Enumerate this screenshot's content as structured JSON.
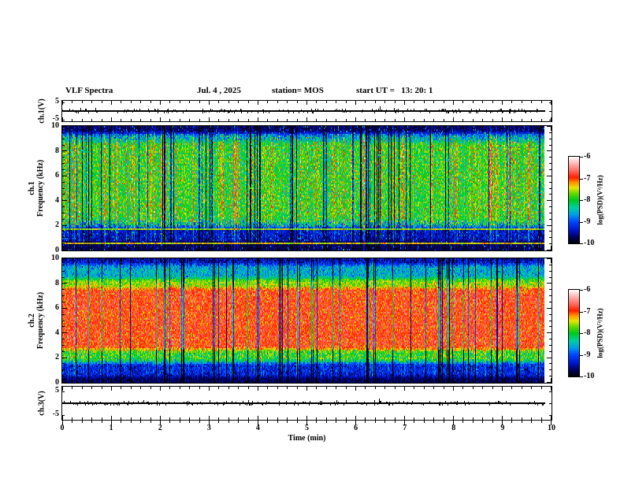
{
  "header": {
    "title": "VLF Spectra",
    "date": "Jul. 4 , 2025",
    "station": "station= MOS",
    "start_ut": "start UT =   13: 20: 1"
  },
  "time_axis": {
    "label": "Time (min)",
    "min": 0,
    "max": 10,
    "major_ticks": [
      0,
      1,
      2,
      3,
      4,
      5,
      6,
      7,
      8,
      9,
      10
    ],
    "minor_step": 0.2
  },
  "colormap": {
    "label": "log(PSD)(V²/Hz)",
    "ticks": [
      -6,
      -7,
      -8,
      -9,
      -10
    ],
    "min": -10,
    "max": -6,
    "stops": [
      [
        0,
        "#000006"
      ],
      [
        0.07,
        "#000055"
      ],
      [
        0.15,
        "#0013c8"
      ],
      [
        0.25,
        "#0045ff"
      ],
      [
        0.33,
        "#009ce6"
      ],
      [
        0.41,
        "#00cfa0"
      ],
      [
        0.5,
        "#00c81e"
      ],
      [
        0.58,
        "#6ed800"
      ],
      [
        0.64,
        "#e6e600"
      ],
      [
        0.7,
        "#ff9600"
      ],
      [
        0.76,
        "#ff1e00"
      ],
      [
        0.84,
        "#ff6e64"
      ],
      [
        0.92,
        "#ffb4b4"
      ],
      [
        1,
        "#ffffff"
      ]
    ]
  },
  "chart_data": [
    {
      "type": "line",
      "name": "ch1_voltage",
      "ylabel": "ch.1(V)",
      "ylim": [
        -5.9,
        5.9
      ],
      "yticks": [
        5,
        -5
      ],
      "signal": "flat trace near 0 V with sparse small impulsive spikes"
    },
    {
      "type": "heatmap",
      "name": "ch1_spectrogram",
      "ylabel_line1": "ch.1",
      "ylabel_line2": "Frequency (kHz)",
      "xlim": [
        0,
        10
      ],
      "ylim": [
        0,
        10
      ],
      "zlim": [
        -10,
        -6
      ],
      "yticks": [
        0,
        2,
        4,
        6,
        8,
        10
      ],
      "data_end": 9.85,
      "bands": [
        {
          "f": [
            9.35,
            10.0
          ],
          "level": -9.7,
          "noise": 0.25,
          "streak_weight": 0.35
        },
        {
          "f": [
            8.7,
            9.35
          ],
          "level": -8.6,
          "noise": 0.5,
          "streak_weight": 0.8
        },
        {
          "f": [
            2.45,
            8.7
          ],
          "level": -7.95,
          "noise": 0.45,
          "streak_weight": 1.0
        },
        {
          "f": [
            1.95,
            2.45
          ],
          "level": -8.3,
          "noise": 0.8,
          "streak_weight": 0.8
        },
        {
          "f": [
            0.8,
            1.95
          ],
          "level": -9.4,
          "noise": 0.35,
          "streak_weight": 0.6
        },
        {
          "f": [
            0.0,
            0.8
          ],
          "level": -9.75,
          "noise": 0.2,
          "streak_weight": 0.3
        }
      ],
      "lines": [
        {
          "f": 1.75,
          "level": -7.6
        },
        {
          "f": 0.6,
          "level": -7.4
        }
      ],
      "streaks": {
        "dark_prob": 0.13,
        "dark_depth": [
          1.0,
          2.2
        ],
        "bright_prob": 0.1,
        "bright_boost": [
          0.5,
          1.1
        ],
        "dark_gain": 1.0
      },
      "speck_prob": 0.05,
      "speck_boost": 1.15
    },
    {
      "type": "heatmap",
      "name": "ch2_spectrogram",
      "ylabel_line1": "ch.2",
      "ylabel_line2": "Frequency (kHz)",
      "xlim": [
        0,
        10
      ],
      "ylim": [
        0,
        10
      ],
      "zlim": [
        -10,
        -6
      ],
      "yticks": [
        0,
        2,
        4,
        6,
        8,
        10
      ],
      "data_end": 9.85,
      "bands": [
        {
          "f": [
            9.55,
            10.0
          ],
          "level": -9.4,
          "noise": 0.35,
          "streak_weight": 0.5
        },
        {
          "f": [
            8.3,
            9.55
          ],
          "level": -8.55,
          "noise": 0.35,
          "streak_weight": 0.55
        },
        {
          "f": [
            7.6,
            8.3
          ],
          "level": -7.6,
          "noise": 0.35,
          "streak_weight": 0.5
        },
        {
          "f": [
            2.6,
            7.6
          ],
          "level": -6.9,
          "noise": 0.3,
          "streak_weight": 0.5
        },
        {
          "f": [
            1.7,
            2.6
          ],
          "level": -7.9,
          "noise": 0.5,
          "streak_weight": 0.8
        },
        {
          "f": [
            0.55,
            1.7
          ],
          "level": -9.2,
          "noise": 0.35,
          "streak_weight": 0.9
        },
        {
          "f": [
            0.0,
            0.55
          ],
          "level": -9.7,
          "noise": 0.2,
          "streak_weight": 0.4
        }
      ],
      "lines": [],
      "streaks": {
        "dark_prob": 0.1,
        "dark_depth": [
          1.0,
          2.5
        ],
        "bright_prob": 0.12,
        "bright_boost": [
          0.2,
          0.5
        ],
        "dark_gain": 2.2
      },
      "speck_prob": 0.1,
      "speck_boost": -0.6
    },
    {
      "type": "line",
      "name": "ch3_voltage",
      "ylabel": "ch.3(V)",
      "ylim": [
        -7,
        7
      ],
      "yticks": [
        5,
        -5
      ],
      "signal": "flat trace near 0 V with sparse small impulsive spikes"
    }
  ]
}
